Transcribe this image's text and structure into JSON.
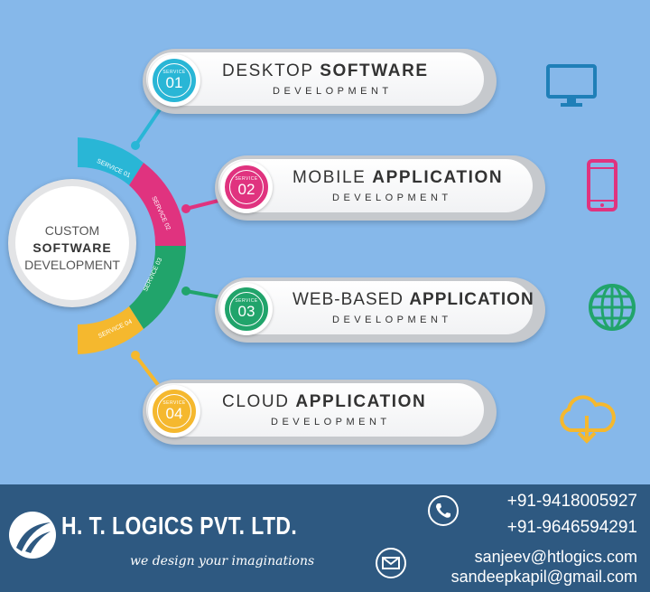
{
  "center": {
    "line1": "CUSTOM",
    "line2": "SOFTWARE",
    "line3": "DEVELOPMENT"
  },
  "services": [
    {
      "badge_label": "SERVICE",
      "number": "01",
      "arc_label": "SERVICE 01",
      "title_plain": "DESKTOP ",
      "title_bold": "SOFTWARE",
      "subtitle": "DEVELOPMENT",
      "color": "#29b6d6",
      "icon": "desktop-monitor-icon"
    },
    {
      "badge_label": "SERVICE",
      "number": "02",
      "arc_label": "SERVICE 02",
      "title_plain": "MOBILE ",
      "title_bold": "APPLICATION",
      "subtitle": "DEVELOPMENT",
      "color": "#e0337f",
      "icon": "smartphone-icon"
    },
    {
      "badge_label": "SERVICE",
      "number": "03",
      "arc_label": "SERVICE 03",
      "title_plain": "WEB-BASED ",
      "title_bold": "APPLICATION",
      "subtitle": "DEVELOPMENT",
      "color": "#21a46b",
      "icon": "globe-icon"
    },
    {
      "badge_label": "SERVICE",
      "number": "04",
      "arc_label": "SERVICE 04",
      "title_plain": "CLOUD ",
      "title_bold": "APPLICATION",
      "subtitle": "DEVELOPMENT",
      "color": "#f5b82e",
      "icon": "cloud-download-icon"
    }
  ],
  "footer": {
    "company": "H. T. LOGICS PVT. LTD.",
    "tagline": "we design your imaginations",
    "phone1": "+91-9418005927",
    "phone2": "+91-9646594291",
    "email1": "sanjeev@htlogics.com",
    "email2": "sandeepkapil@gmail.com",
    "phone_icon": "phone-icon",
    "email_icon": "envelope-icon",
    "logo_icon": "swoosh-logo-icon",
    "background_color": "#2e5981"
  },
  "background_color": "#86b8ea"
}
